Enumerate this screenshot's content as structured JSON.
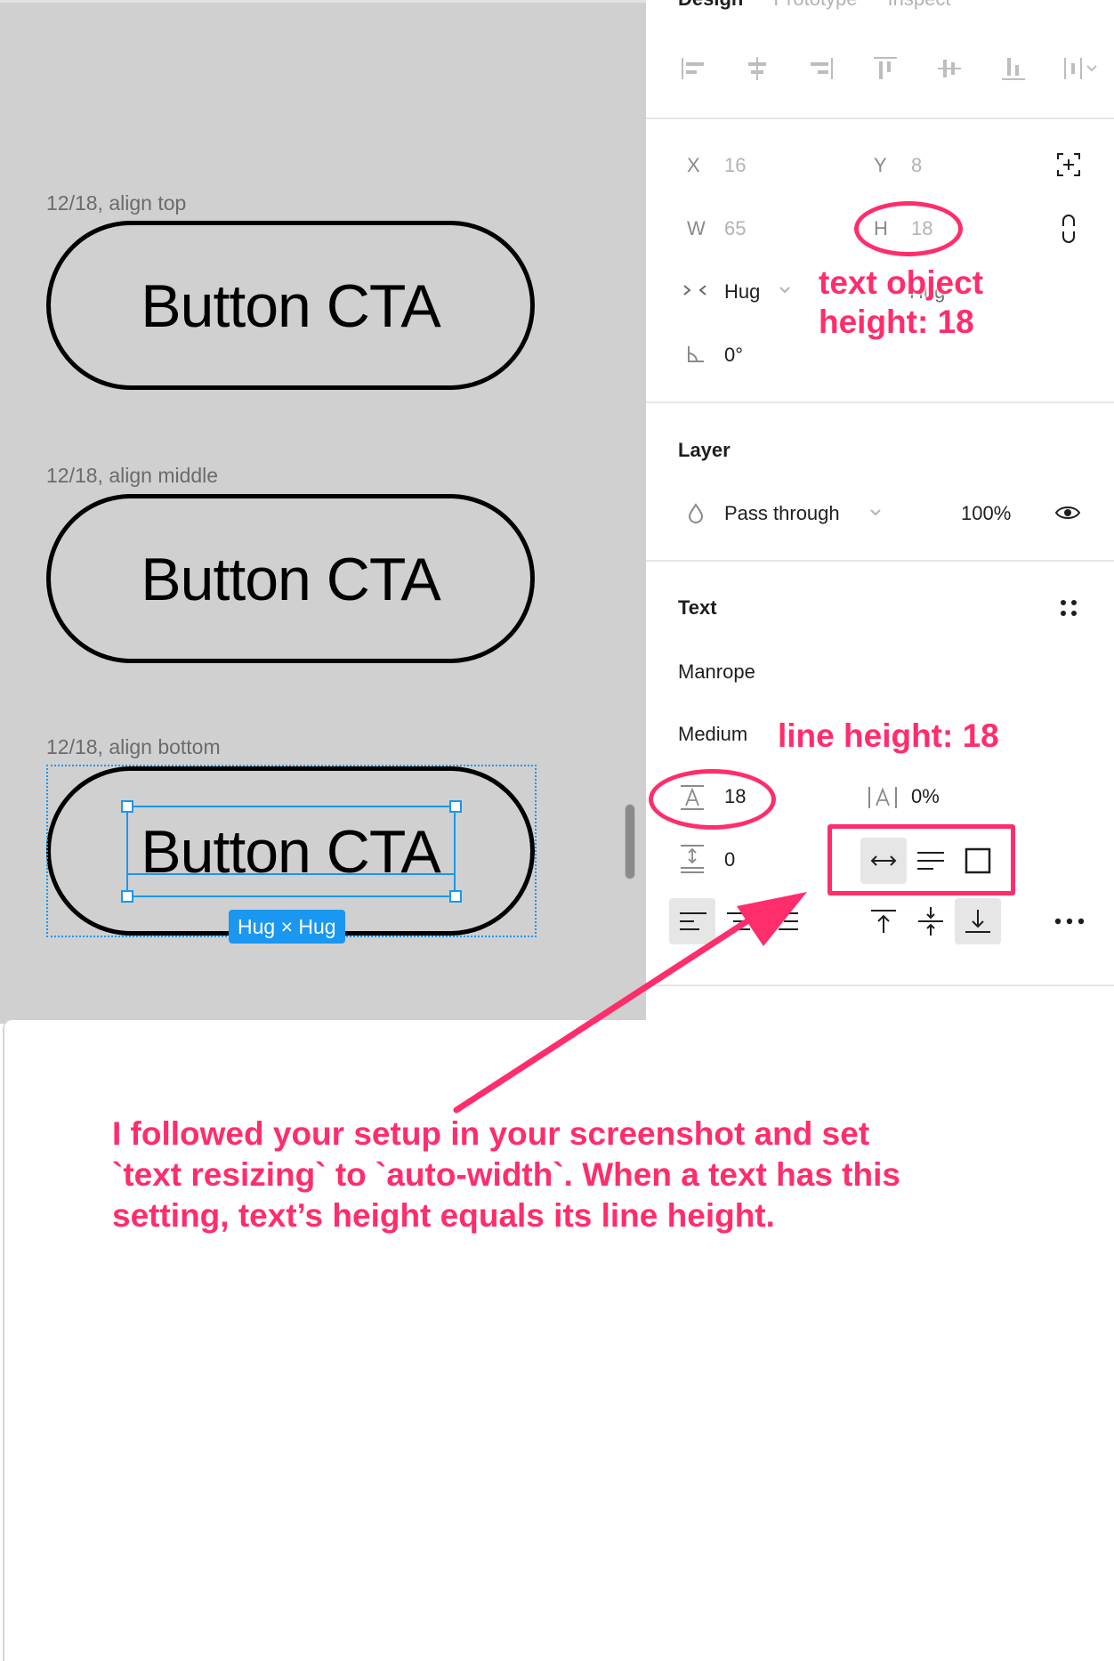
{
  "canvas": {
    "frames": [
      {
        "label": "12/18, align top",
        "button_text": "Button CTA"
      },
      {
        "label": "12/18, align middle",
        "button_text": "Button CTA"
      },
      {
        "label": "12/18, align bottom",
        "button_text": "Button CTA",
        "selected": true
      }
    ],
    "selection_badge": "Hug × Hug"
  },
  "panel": {
    "tabs": [
      {
        "label": "Design",
        "active": true
      },
      {
        "label": "Prototype",
        "active": false
      },
      {
        "label": "Inspect",
        "active": false
      }
    ],
    "align_icons": [
      "align-left-icon",
      "align-horizontal-center-icon",
      "align-right-icon",
      "align-top-icon",
      "align-vertical-center-icon",
      "align-bottom-icon",
      "distribute-icon"
    ],
    "position": {
      "x_label": "X",
      "x_value": "16",
      "y_label": "Y",
      "y_value": "8",
      "w_label": "W",
      "w_value": "65",
      "h_label": "H",
      "h_value": "18",
      "width_sizing": "Hug",
      "height_sizing": "Hug",
      "rotation": "0°"
    },
    "layer": {
      "title": "Layer",
      "blend_mode": "Pass through",
      "opacity": "100%"
    },
    "text": {
      "title": "Text",
      "font_family": "Manrope",
      "font_weight": "Medium",
      "line_height": "18",
      "letter_spacing": "0%",
      "paragraph_spacing": "0",
      "resizing_options": [
        "auto-width",
        "auto-height",
        "fixed-size"
      ],
      "resizing_selected": "auto-width",
      "horizontal_align_selected": "left",
      "vertical_align_selected": "bottom"
    }
  },
  "annotations": {
    "height_note_line1": "text object",
    "height_note_line2": "height: 18",
    "line_height_note": "line height: 18",
    "explanation": "I followed your setup in your screenshot and set `text resizing` to `auto-width`. When a text has this setting, text’s height equals its line height.",
    "color": "#ff2d6b"
  }
}
